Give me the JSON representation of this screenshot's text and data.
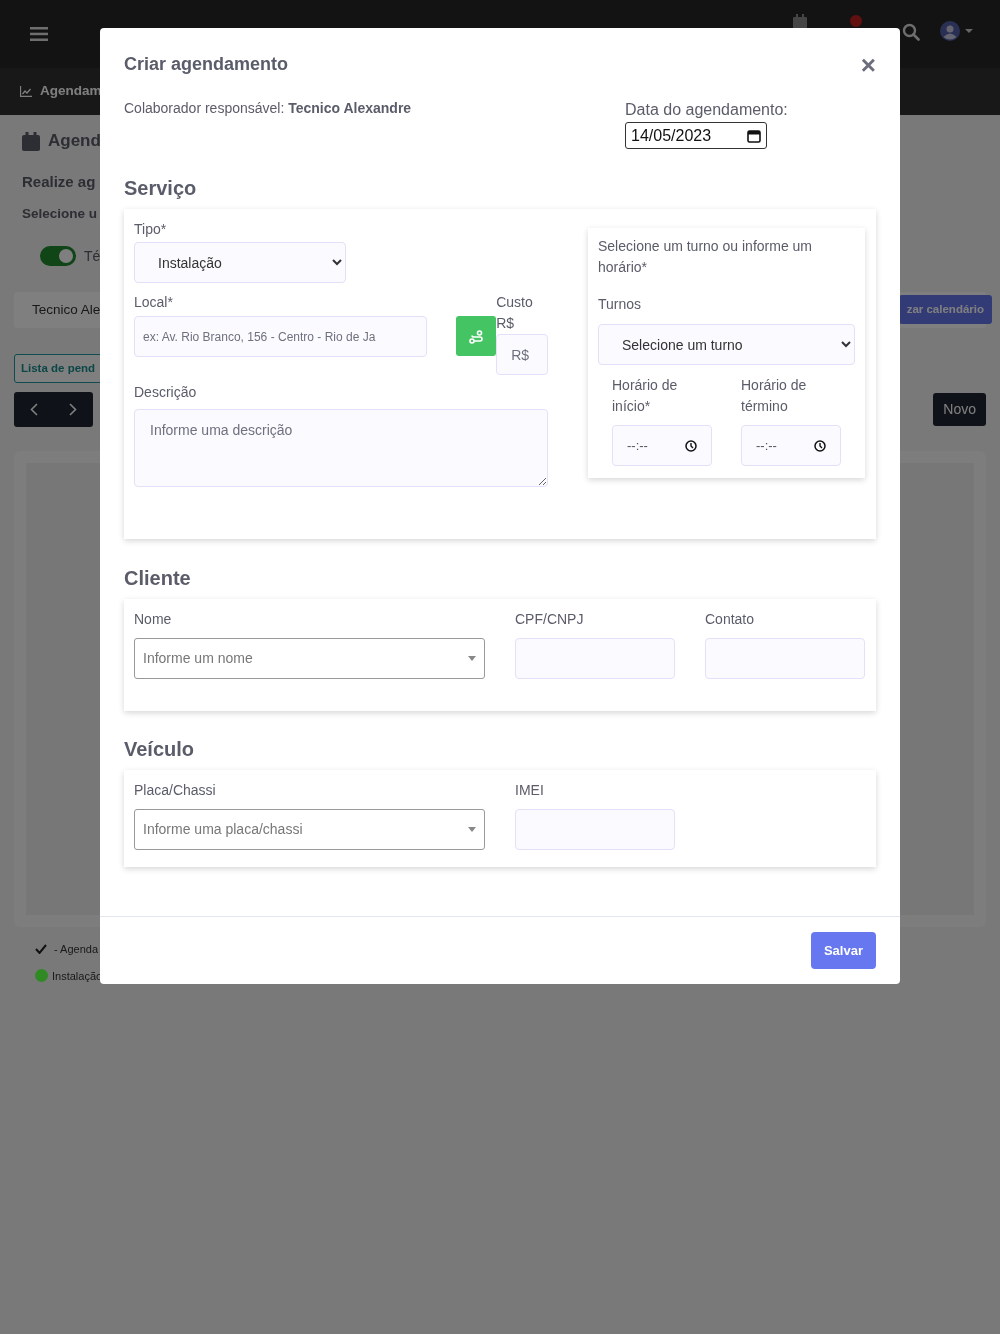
{
  "app": {
    "subnav": {
      "label": "Agendam"
    },
    "page": {
      "title": "Agend",
      "subtitle": "Realize ag",
      "instruction": "Selecione u",
      "toggle": {
        "label": "Té",
        "on": true
      },
      "technician_select": "Tecnico Ale",
      "calendar_button": "zar calendário",
      "pending_button": "Lista de pend",
      "new_button": "Novo",
      "legend": [
        {
          "kind": "check",
          "label": "- Agenda"
        },
        {
          "kind": "dot",
          "color": "#2f8a24",
          "label": "Instalação"
        }
      ]
    }
  },
  "modal": {
    "title": "Criar agendamento",
    "close": "×",
    "responsible": "Colaborador responsável: **Tecnico Alexandre**",
    "date": {
      "label": "Data do agendamento:",
      "value": "14/05/2023"
    },
    "service": {
      "heading": "Serviço",
      "type": {
        "label": "Tipo*",
        "value": "Instalação"
      },
      "location": {
        "label": "Local*",
        "placeholder": "ex: Av. Rio Branco, 156 - Centro - Rio de Ja"
      },
      "cost": {
        "label": "Custo R$",
        "placeholder": "R$"
      },
      "description": {
        "label": "Descrição",
        "placeholder": "Informe uma descrição"
      },
      "schedule": {
        "hint": "Selecione um turno ou informe um horário*",
        "shift": {
          "label": "Turnos",
          "value": "Selecione um turno"
        },
        "start": {
          "label": "Horário de início*",
          "value": "--:--"
        },
        "end": {
          "label": "Horário de término",
          "value": "--:--"
        }
      }
    },
    "client": {
      "heading": "Cliente",
      "fields": [
        {
          "kind": "combo",
          "label": "Nome",
          "placeholder": "Informe um nome"
        },
        {
          "kind": "input",
          "label": "CPF/CNPJ"
        },
        {
          "kind": "input",
          "label": "Contato"
        }
      ]
    },
    "vehicle": {
      "heading": "Veículo",
      "fields": [
        {
          "kind": "combo",
          "label": "Placa/Chassi",
          "placeholder": "Informe uma placa/chassi"
        },
        {
          "kind": "input",
          "label": "IMEI"
        }
      ]
    },
    "footer": {
      "save": "Salvar"
    }
  }
}
